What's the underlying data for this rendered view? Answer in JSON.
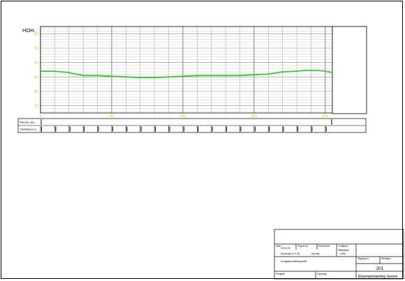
{
  "profile_chart": {
    "y_axis_title": "HOH.",
    "x_tick_labels": [
      "0",
      "50",
      "100",
      "150",
      "200"
    ],
    "y_tick_labels": [
      "30",
      "40",
      "50",
      "60",
      "70",
      "80"
    ],
    "row_labels": [
      "PROFIL NR.",
      "TERRENG H."
    ],
    "colors": {
      "terrain_line": "#2bd12b",
      "grid_minor": "#b8b8b8",
      "axis_labels": "#e0c000"
    }
  },
  "chart_data": {
    "type": "line",
    "title": "",
    "xlabel": "",
    "ylabel": "HOH.",
    "xlim": [
      0,
      205
    ],
    "ylim": [
      25,
      85
    ],
    "grid": true,
    "series": [
      {
        "x": [
          0,
          10,
          20,
          25,
          30,
          40,
          50,
          60,
          70,
          80,
          90,
          100,
          110,
          120,
          130,
          140,
          150,
          160,
          170,
          180,
          185,
          190,
          195,
          200,
          205
        ],
        "y": [
          54,
          54,
          53,
          52,
          51,
          51,
          50.5,
          50,
          49.5,
          49.5,
          50,
          50.5,
          51,
          51,
          51,
          51,
          51.5,
          52,
          53.5,
          54,
          54.5,
          54.5,
          54.5,
          54,
          53
        ]
      }
    ]
  },
  "title_block": {
    "dato_label": "Dato",
    "dato_value": "15.03.03",
    "tegnet_label": "Tegnet av",
    "kontrollert_label": "Kontrollert",
    "godkjent_label": "Godkjent",
    "malestokk_label": "Målestokk",
    "malestokk_value": "1:500",
    "note_left": "Eksempel nr 3  Nr.",
    "note_right": "Ny linje",
    "drawing_type": "Lengdeprofil/fasprofil",
    "tegning_nr_label": "Tegning nr",
    "revisjon_label": "Revisjon",
    "drawing_number": "201",
    "prosjekt_label": "Prosjekt",
    "oppdrag_label": "Oppdrag",
    "project_name": "Eksempelsamling Gemini"
  }
}
